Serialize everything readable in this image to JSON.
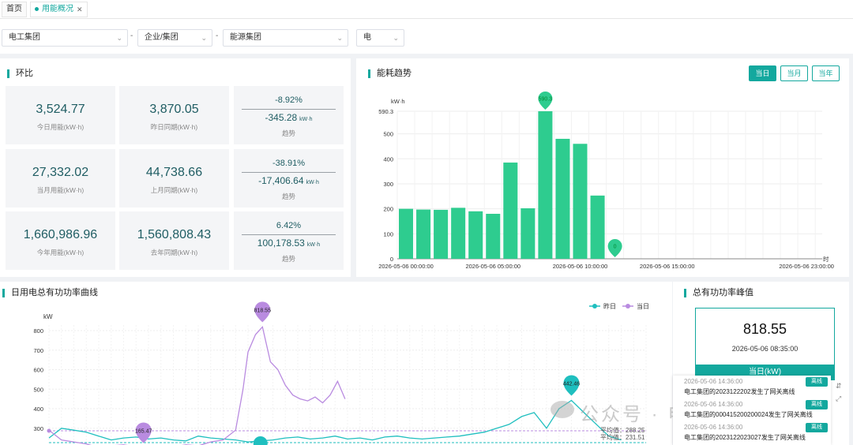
{
  "tabs": [
    {
      "label": "首页",
      "active": false
    },
    {
      "label": "用能概况",
      "active": true
    }
  ],
  "filters": {
    "group": "电工集团",
    "type": "企业/集团",
    "enterprise": "能源集团",
    "energy": "电",
    "separator": "-"
  },
  "compare": {
    "title": "环比",
    "rows": [
      {
        "current": "3,524.77",
        "current_label": "今日用能(kW·h)",
        "previous": "3,870.05",
        "previous_label": "昨日同期(kW·h)",
        "pct": "-8.92%",
        "diff": "-345.28",
        "unit": "kW·h",
        "trend_label": "趋势"
      },
      {
        "current": "27,332.02",
        "current_label": "当月用能(kW·h)",
        "previous": "44,738.66",
        "previous_label": "上月同期(kW·h)",
        "pct": "-38.91%",
        "diff": "-17,406.64",
        "unit": "kW·h",
        "trend_label": "趋势"
      },
      {
        "current": "1,660,986.96",
        "current_label": "今年用能(kW·h)",
        "previous": "1,560,808.43",
        "previous_label": "去年同期(kW·h)",
        "pct": "6.42%",
        "diff": "100,178.53",
        "unit": "kW·h",
        "trend_label": "趋势"
      }
    ]
  },
  "trend": {
    "title": "能耗趋势",
    "buttons": [
      {
        "label": "当日",
        "active": true
      },
      {
        "label": "当月",
        "active": false
      },
      {
        "label": "当年",
        "active": false
      }
    ]
  },
  "power": {
    "title": "日用电总有功功率曲线",
    "legend": [
      "昨日",
      "当日"
    ],
    "avg_label_1": "平均值：288.25",
    "avg_label_2": "平均值：231.51"
  },
  "peak": {
    "title": "总有功功率峰值",
    "value": "818.55",
    "time": "2026-05-06 08:35:00",
    "bar_label": "当日(kW)"
  },
  "notices": [
    {
      "time": "2026-05-06 14:36:00",
      "badge": "离线",
      "text": "电工集团的2023122202发生了网关离线"
    },
    {
      "time": "2026-05-06 14:36:00",
      "badge": "离线",
      "text": "电工集团的000415200200024发生了网关离线"
    },
    {
      "time": "2026-05-06 14:36:00",
      "badge": "离线",
      "text": "电工集团的2023122023027发生了网关离线"
    }
  ],
  "watermark": "公众号 · 电气工程指南",
  "colors": {
    "accent": "#13a89e",
    "bar": "#2ecc8f",
    "today_line": "#b98be0",
    "yesterday_line": "#1fbfbf"
  },
  "chart_data": [
    {
      "type": "bar",
      "ylabel": "kW·h",
      "xlabel": "时",
      "ylim": [
        0,
        590.3
      ],
      "yticks": [
        "0",
        "100",
        "200",
        "300",
        "400",
        "500",
        "590.3"
      ],
      "xtick_labels": [
        "2026-05-06 00:00:00",
        "2026-05-06 05:00:00",
        "2026-05-06 10:00:00",
        "2026-05-06 15:00:00",
        "2026-05-06 23:00:00"
      ],
      "categories": [
        "0",
        "1",
        "2",
        "3",
        "4",
        "5",
        "6",
        "7",
        "8",
        "9",
        "10",
        "11",
        "12",
        "13",
        "14",
        "15",
        "16",
        "17",
        "18",
        "19",
        "20",
        "21",
        "22",
        "23"
      ],
      "values": [
        200,
        197,
        196,
        204,
        190,
        180,
        385,
        202,
        590.3,
        480,
        460,
        253,
        0
      ],
      "markers": [
        {
          "label": "590.3",
          "index": 8
        },
        {
          "label": "0",
          "index": 12
        }
      ]
    },
    {
      "type": "line",
      "ylabel": "kW",
      "yticks": [
        "300",
        "400",
        "500",
        "600",
        "700",
        "800"
      ],
      "series": [
        {
          "name": "当日",
          "x_hours": [
            0,
            0.5,
            1,
            1.5,
            2,
            2.5,
            3,
            3.5,
            4,
            4.5,
            5,
            5.5,
            6,
            6.5,
            7,
            7.5,
            7.8,
            8,
            8.3,
            8.58,
            8.9,
            9.2,
            9.5,
            9.8,
            10.1,
            10.4,
            10.7,
            11,
            11.3,
            11.6,
            11.9
          ],
          "values": [
            290,
            240,
            230,
            220,
            200,
            210,
            215,
            205,
            200,
            210,
            205,
            215,
            210,
            230,
            240,
            290,
            500,
            690,
            780,
            818.55,
            640,
            600,
            520,
            470,
            450,
            440,
            460,
            430,
            470,
            540,
            450
          ]
        },
        {
          "name": "昨日",
          "x_hours": [
            0,
            0.5,
            1,
            1.5,
            2,
            2.5,
            3,
            3.5,
            4,
            4.5,
            5,
            5.5,
            6,
            6.5,
            7,
            7.5,
            8,
            8.5,
            9,
            9.5,
            10,
            10.5,
            11,
            11.5,
            12,
            12.5,
            13,
            13.5,
            14,
            14.5,
            15,
            15.5,
            16,
            16.5,
            17,
            17.5,
            18,
            18.5,
            19,
            19.5,
            20,
            20.5,
            21,
            21.5,
            22,
            22.5,
            23
          ],
          "values": [
            250,
            300,
            290,
            280,
            260,
            240,
            250,
            255,
            245,
            250,
            240,
            235,
            260,
            250,
            245,
            240,
            230,
            235,
            240,
            250,
            255,
            245,
            250,
            260,
            245,
            250,
            240,
            255,
            260,
            250,
            245,
            250,
            255,
            260,
            270,
            280,
            300,
            320,
            360,
            380,
            300,
            400,
            442.46,
            380,
            320,
            260,
            240
          ]
        }
      ],
      "peak_markers": [
        {
          "label": "818.55",
          "series": "当日"
        },
        {
          "label": "442.46",
          "series": "昨日"
        },
        {
          "label": "165.47",
          "series": "当日"
        }
      ]
    }
  ]
}
